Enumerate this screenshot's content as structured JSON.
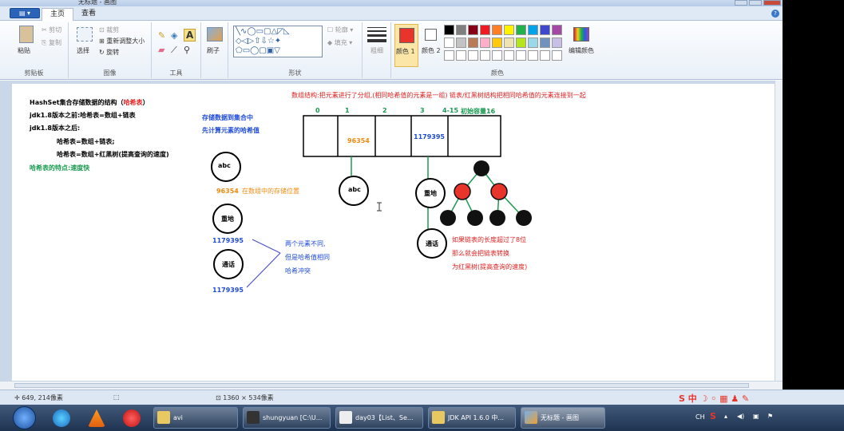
{
  "titlebar": {
    "title": "无标题 - 画图"
  },
  "menu": {
    "file": "",
    "tabs": [
      "主页",
      "查看"
    ]
  },
  "ribbon": {
    "clipboard": {
      "paste": "粘贴",
      "cut": "剪切",
      "copy": "复制",
      "label": "剪贴板"
    },
    "image": {
      "select": "选择",
      "crop": "裁剪",
      "resize": "重新调整大小",
      "rotate": "旋转",
      "label": "图像"
    },
    "tools": {
      "label": "工具"
    },
    "brushes": {
      "label": "刷子"
    },
    "shapes": {
      "outline": "轮廓",
      "fill": "填充",
      "label": "形状"
    },
    "size": {
      "label": "粗细"
    },
    "colors": {
      "color1": "颜色 1",
      "color2": "颜色 2",
      "edit": "编辑颜色",
      "label": "颜色",
      "color1_value": "#e8342a",
      "color2_value": "#ffffff",
      "palette_row1": [
        "#000000",
        "#7f7f7f",
        "#880015",
        "#ed1c24",
        "#ff7f27",
        "#fff200",
        "#22b14c",
        "#00a2e8",
        "#3f48cc",
        "#a349a4"
      ],
      "palette_row2": [
        "#ffffff",
        "#c3c3c3",
        "#b97a57",
        "#ffaec9",
        "#ffc90e",
        "#efe4b0",
        "#b5e61d",
        "#99d9ea",
        "#7092be",
        "#c8bfe7"
      ]
    }
  },
  "canvas_text": {
    "hs1": "HashSet集合存储数据的结构（",
    "hs1b": "哈希表",
    "hs1c": "）",
    "hs2": "jdk1.8版本之前:哈希表=数组+链表",
    "hs3": "jdk1.8版本之后:",
    "hs4": "哈希表=数组+链表;",
    "hs5": "哈希表=数组+红黑树(提高查询的速度)",
    "hs6": "哈希表的特点:速度快",
    "store1": "存储数据到集合中",
    "store2": "先计算元素的哈希值",
    "abc": "abc",
    "hash1": "96354",
    "pos": "在数组中的存储位置",
    "chongdi": "重地",
    "tonghua": "通话",
    "hash2": "1179395",
    "hash3": "1179395",
    "note1": "两个元素不同,",
    "note2": "但是哈希值相同",
    "note3": "哈希冲突",
    "arr_title": "数组结构:把元素进行了分组,(相同哈希值的元素是一组) 链表/红黑树结构把相同哈希值的元素连接到一起",
    "idx0": "0",
    "idx1": "1",
    "idx2": "2",
    "idx3": "3",
    "idx4": "4-15",
    "init": "初始容量16",
    "cell1": "96354",
    "cell3": "1179395",
    "node_abc": "abc",
    "node_chongdi": "重地",
    "node_tonghua": "通话",
    "rb1": "如果链表的长度超过了8位",
    "rb2": "那么就会把链表转换",
    "rb3": "为红黑树(提高查询的速度)"
  },
  "status": {
    "coords": "649, 214像素",
    "size": "1360 × 534像素"
  },
  "taskbar": {
    "items": [
      "avi",
      "shungyuan [C:\\U...",
      "day03【List、Se...",
      "JDK API 1.6.0 中...",
      "无标题 - 画图"
    ]
  }
}
